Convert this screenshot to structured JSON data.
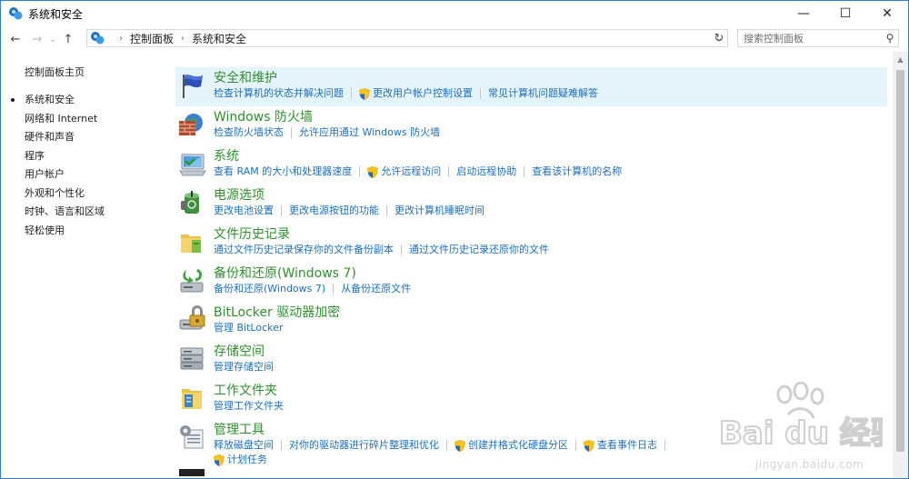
{
  "window": {
    "title": "系统和安全",
    "controls": {
      "minimize": "—",
      "maximize": "☐",
      "close": "✕"
    }
  },
  "nav": {
    "back": "←",
    "forward": "→",
    "recent": "⌄",
    "up": "↑",
    "breadcrumb": [
      "控制面板",
      "系统和安全"
    ],
    "search_placeholder": "搜索控制面板"
  },
  "sidebar": {
    "home": "控制面板主页",
    "items": [
      {
        "label": "系统和安全",
        "active": true
      },
      {
        "label": "网络和 Internet",
        "active": false
      },
      {
        "label": "硬件和声音",
        "active": false
      },
      {
        "label": "程序",
        "active": false
      },
      {
        "label": "用户帐户",
        "active": false
      },
      {
        "label": "外观和个性化",
        "active": false
      },
      {
        "label": "时钟、语言和区域",
        "active": false
      },
      {
        "label": "轻松使用",
        "active": false
      }
    ]
  },
  "categories": [
    {
      "title": "安全和维护",
      "links": [
        "检查计算机的状态并解决问题",
        "更改用户帐户控制设置",
        "常见计算机问题疑难解答"
      ]
    },
    {
      "title": "Windows 防火墙",
      "links": [
        "检查防火墙状态",
        "允许应用通过 Windows 防火墙"
      ]
    },
    {
      "title": "系统",
      "links": [
        "查看 RAM 的大小和处理器速度",
        "允许远程访问",
        "启动远程协助",
        "查看该计算机的名称"
      ]
    },
    {
      "title": "电源选项",
      "links": [
        "更改电池设置",
        "更改电源按钮的功能",
        "更改计算机睡眠时间"
      ]
    },
    {
      "title": "文件历史记录",
      "links": [
        "通过文件历史记录保存你的文件备份副本",
        "通过文件历史记录还原你的文件"
      ]
    },
    {
      "title": "备份和还原(Windows 7)",
      "links": [
        "备份和还原(Windows 7)",
        "从备份还原文件"
      ]
    },
    {
      "title": "BitLocker 驱动器加密",
      "links": [
        "管理 BitLocker"
      ]
    },
    {
      "title": "存储空间",
      "links": [
        "管理存储空间"
      ]
    },
    {
      "title": "工作文件夹",
      "links": [
        "管理工作文件夹"
      ]
    },
    {
      "title": "管理工具",
      "links": [
        "释放磁盘空间",
        "对你的驱动器进行碎片整理和优化",
        "创建并格式化硬盘分区",
        "查看事件日志",
        "计划任务"
      ]
    }
  ],
  "colors": {
    "accent_border": "#2b7fd9",
    "category_title": "#2f8f2f",
    "link": "#1d6fb8",
    "highlight_row": "#e5f3fb"
  },
  "watermark": {
    "text": "jingyan.baidu.com",
    "brand": "Bai du 经验"
  }
}
